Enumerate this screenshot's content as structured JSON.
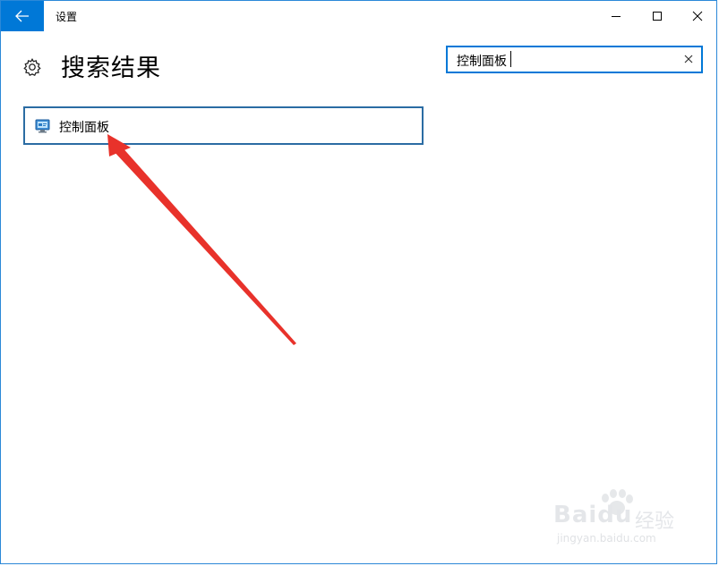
{
  "window": {
    "title": "设置"
  },
  "header": {
    "page_title": "搜索结果"
  },
  "search": {
    "value": "控制面板"
  },
  "results": [
    {
      "label": "控制面板",
      "icon": "control-panel-icon"
    }
  ],
  "watermark": {
    "brand": "Baidu",
    "sub": "经验",
    "url": "jingyan.baidu.com"
  },
  "colors": {
    "accent": "#0078d7",
    "annotation_arrow": "#e8322b",
    "result_border": "#2b6ca3"
  }
}
